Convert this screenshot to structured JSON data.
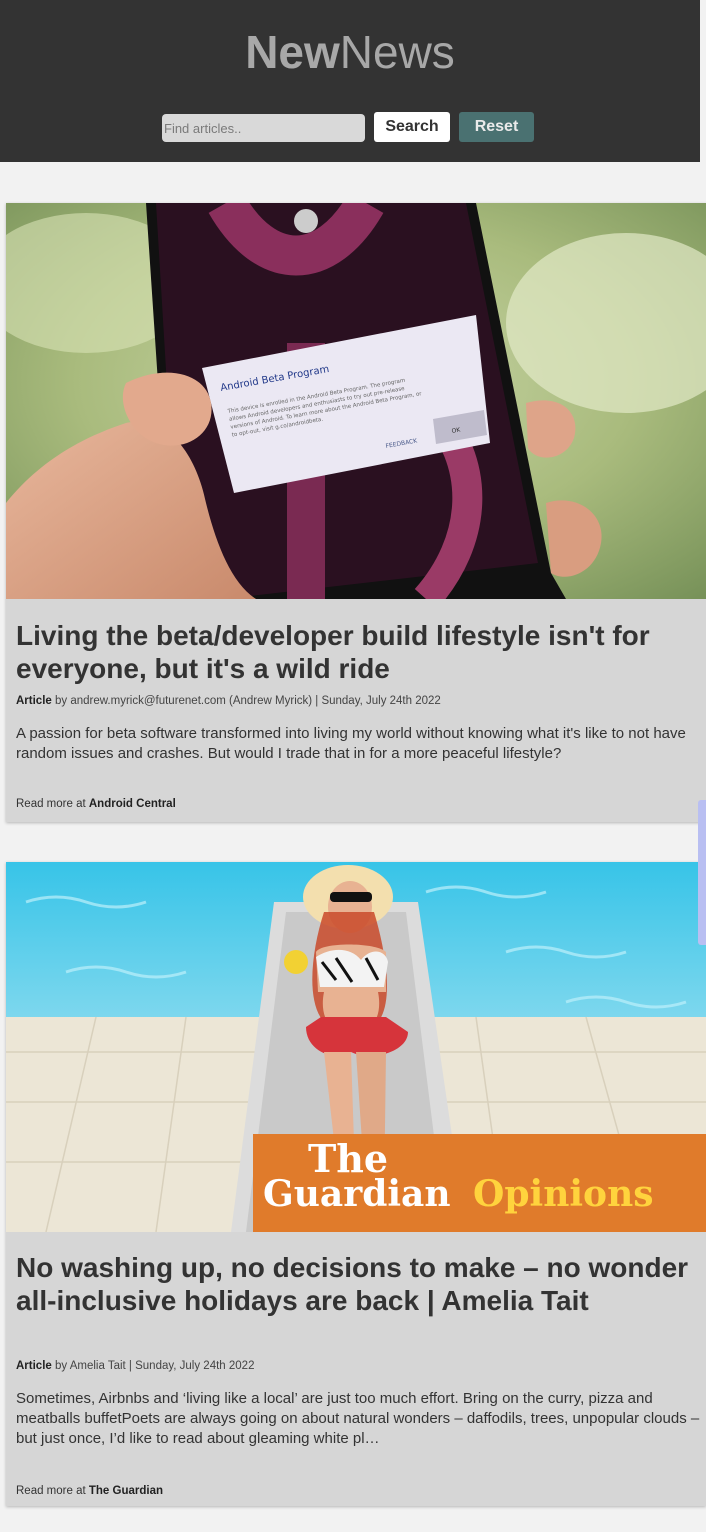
{
  "header": {
    "logo_bold": "New",
    "logo_light": "News",
    "search_placeholder": "Find articles..",
    "search_label": "Search",
    "reset_label": "Reset"
  },
  "articles": [
    {
      "title": "Living the beta/developer build lifestyle isn't for everyone, but it's a wild ride",
      "type": "Article",
      "byline": "by andrew.myrick@futurenet.com (Andrew Myrick) | Sunday, July 24th 2022",
      "description": "A passion for beta software transformed into living my world without knowing what it's like to not have random issues and crashes. But would I trade that in for a more peaceful lifestyle?",
      "read_more_prefix": "Read more at ",
      "source": "Android Central",
      "image": {
        "dialog_title": "Android Beta Program",
        "dialog_body": "This device is enrolled in the Android Beta Program. The program allows Android developers and enthusiasts to try out pre-release versions of Android. To learn more about the Android Beta Program, or to opt-out, visit g.co/androidbeta.",
        "dialog_feedback": "FEEDBACK",
        "dialog_ok": "OK"
      }
    },
    {
      "title": "No washing up, no decisions to make – no wonder all-inclusive holidays are back | Amelia Tait",
      "type": "Article",
      "byline": "by Amelia Tait | Sunday, July 24th 2022",
      "description": "Sometimes, Airbnbs and ‘living like a local’ are just too much effort. Bring on the curry, pizza and meatballs buffetPoets are always going on about natural wonders – daffodils, trees, unpopular clouds – but just once, I’d like to read about gleaming white pl…",
      "read_more_prefix": "Read more at ",
      "source": "The Guardian",
      "image": {
        "brand_line1": "The",
        "brand_line2": "Guardian",
        "brand_section": "Opinions"
      }
    }
  ],
  "colors": {
    "header_bg": "#333333",
    "reset_bg": "#4a7171",
    "card_bg": "#d6d6d6",
    "guardian_orange": "#e07b2b",
    "guardian_yellow": "#ffd33d"
  }
}
